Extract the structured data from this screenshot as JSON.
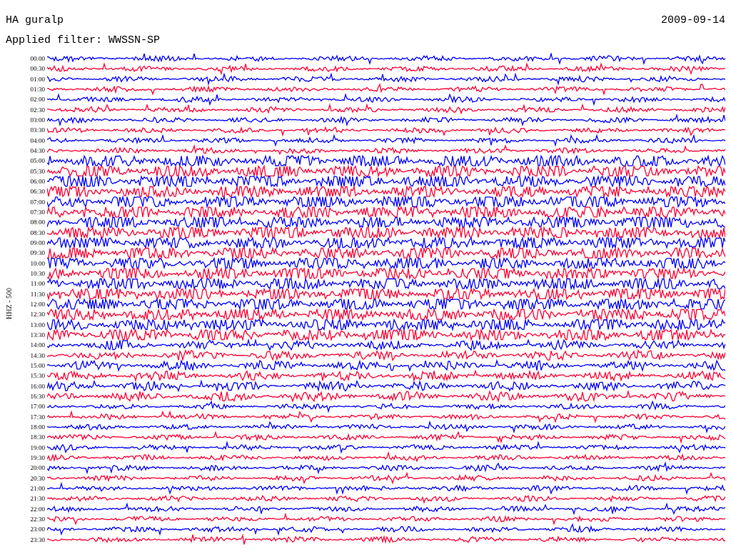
{
  "header": {
    "station": "HA guralp",
    "date": "2009-09-14",
    "filter": "Applied filter: WWSSN-SP"
  },
  "axis_label": "HHZ - 500",
  "rows": [
    {
      "time": "00:00",
      "color": "#0000ff"
    },
    {
      "time": "00:30",
      "color": "#ff0033"
    },
    {
      "time": "01:00",
      "color": "#0000ff"
    },
    {
      "time": "01:30",
      "color": "#ff0033"
    },
    {
      "time": "02:00",
      "color": "#0000ff"
    },
    {
      "time": "02:30",
      "color": "#ff0033"
    },
    {
      "time": "03:00",
      "color": "#0000ff"
    },
    {
      "time": "03:30",
      "color": "#ff0033"
    },
    {
      "time": "04:00",
      "color": "#0000ff"
    },
    {
      "time": "04:30",
      "color": "#ff0033"
    },
    {
      "time": "05:00",
      "color": "#0000ff"
    },
    {
      "time": "05:30",
      "color": "#ff0033"
    },
    {
      "time": "06:00",
      "color": "#0000ff"
    },
    {
      "time": "06:30",
      "color": "#ff0033"
    },
    {
      "time": "07:00",
      "color": "#0000ff"
    },
    {
      "time": "07:30",
      "color": "#ff0033"
    },
    {
      "time": "08:00",
      "color": "#0000ff"
    },
    {
      "time": "08:30",
      "color": "#ff0033"
    },
    {
      "time": "09:00",
      "color": "#0000ff"
    },
    {
      "time": "09:30",
      "color": "#ff0033"
    },
    {
      "time": "10:00",
      "color": "#0000ff"
    },
    {
      "time": "10:30",
      "color": "#ff0033"
    },
    {
      "time": "11:00",
      "color": "#0000ff"
    },
    {
      "time": "11:30",
      "color": "#ff0033"
    },
    {
      "time": "12:00",
      "color": "#0000ff"
    },
    {
      "time": "12:30",
      "color": "#ff0033"
    },
    {
      "time": "13:00",
      "color": "#0000ff"
    },
    {
      "time": "13:30",
      "color": "#ff0033"
    },
    {
      "time": "14:00",
      "color": "#0000ff"
    },
    {
      "time": "14:30",
      "color": "#ff0033"
    },
    {
      "time": "15:00",
      "color": "#0000ff"
    },
    {
      "time": "15:30",
      "color": "#ff0033"
    },
    {
      "time": "16:00",
      "color": "#0000ff"
    },
    {
      "time": "16:30",
      "color": "#ff0033"
    },
    {
      "time": "17:00",
      "color": "#0000ff"
    },
    {
      "time": "17:30",
      "color": "#ff0033"
    },
    {
      "time": "18:00",
      "color": "#0000ff"
    },
    {
      "time": "18:30",
      "color": "#ff0033"
    },
    {
      "time": "19:00",
      "color": "#0000ff"
    },
    {
      "time": "19:30",
      "color": "#ff0033"
    },
    {
      "time": "20:00",
      "color": "#0000ff"
    },
    {
      "time": "20:30",
      "color": "#ff0033"
    },
    {
      "time": "21:00",
      "color": "#0000ff"
    },
    {
      "time": "21:30",
      "color": "#ff0033"
    },
    {
      "time": "22:00",
      "color": "#0000ff"
    },
    {
      "time": "22:30",
      "color": "#ff0033"
    },
    {
      "time": "23:00",
      "color": "#0000ff"
    },
    {
      "time": "23:30",
      "color": "#ff0033"
    }
  ]
}
